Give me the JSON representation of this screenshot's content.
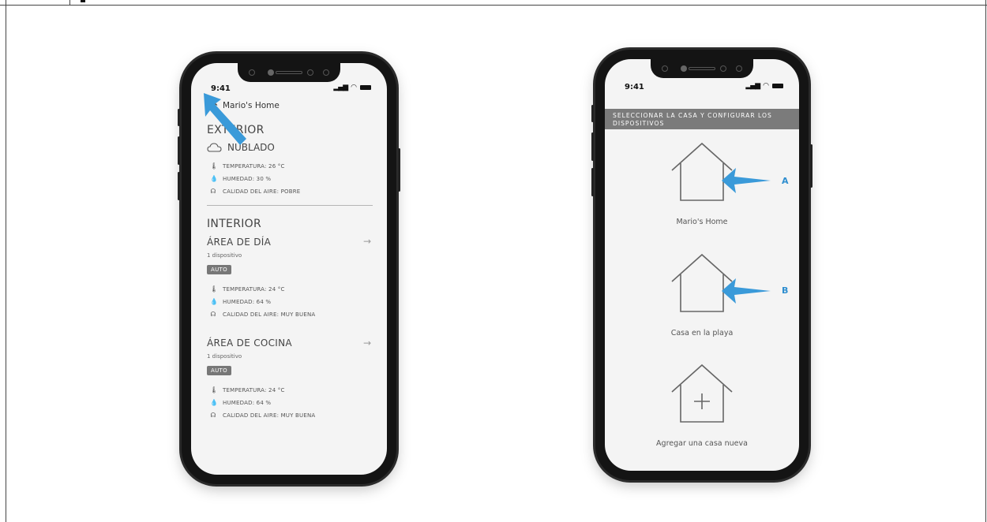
{
  "colors": {
    "accent_arrow": "#3a9ad9",
    "badge": "#777777",
    "banner": "#7b7b7b"
  },
  "phone_left": {
    "status": {
      "time": "9:41",
      "signal": "signal-icon",
      "wifi": "wifi-icon",
      "battery": "battery-icon"
    },
    "home_name": "Mario's Home",
    "exterior": {
      "title": "EXTERIOR",
      "weather": "NUBLADO",
      "metrics": [
        {
          "icon": "thermometer-icon",
          "label": "TEMPERATURA: 26 °C"
        },
        {
          "icon": "drop-icon",
          "label": "HUMEDAD: 30 %"
        },
        {
          "icon": "air-quality-icon",
          "label": "CALIDAD DEL AIRE: POBRE"
        }
      ]
    },
    "interior": {
      "title": "INTERIOR",
      "areas": [
        {
          "name": "ÁREA DE DÍA",
          "devices": "1 dispositivo",
          "mode": "AUTO",
          "metrics": [
            {
              "icon": "thermometer-icon",
              "label": "TEMPERATURA: 24 °C"
            },
            {
              "icon": "drop-icon",
              "label": "HUMEDAD: 64 %"
            },
            {
              "icon": "air-quality-icon",
              "label": "CALIDAD DEL AIRE: MUY BUENA"
            }
          ]
        },
        {
          "name": "ÁREA DE COCINA",
          "devices": "1 dispositivo",
          "mode": "AUTO",
          "metrics": [
            {
              "icon": "thermometer-icon",
              "label": "TEMPERATURA: 24 °C"
            },
            {
              "icon": "drop-icon",
              "label": "HUMEDAD: 64 %"
            },
            {
              "icon": "air-quality-icon",
              "label": "CALIDAD DEL AIRE: MUY BUENA"
            }
          ]
        }
      ]
    }
  },
  "phone_right": {
    "status": {
      "time": "9:41"
    },
    "banner": "SELECCIONAR LA CASA Y CONFIGURAR LOS DISPOSITIVOS",
    "homes": [
      {
        "label": "Mario's Home",
        "annotation": "A"
      },
      {
        "label": "Casa en la playa",
        "annotation": "B"
      },
      {
        "label": "Agregar una casa nueva",
        "annotation": ""
      }
    ]
  }
}
